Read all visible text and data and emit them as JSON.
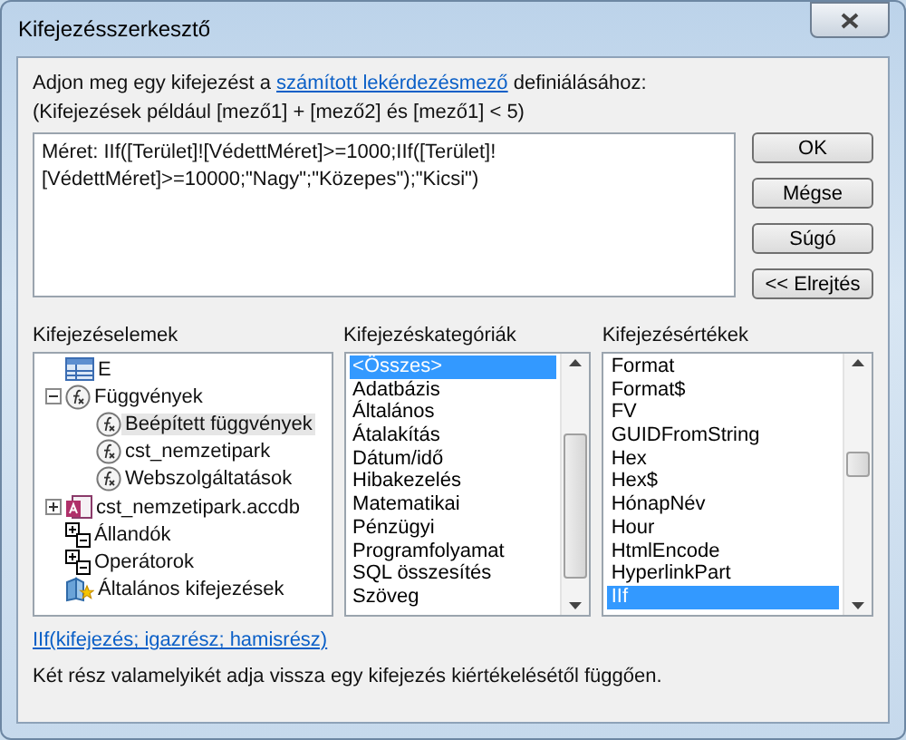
{
  "window": {
    "title": "Kifejezésszerkesztő"
  },
  "intro": {
    "before": "Adjon meg egy kifejezést a ",
    "link": "számított lekérdezésmező",
    "after": " definiálásához:"
  },
  "example": "(Kifejezések például [mező1] + [mező2] és [mező1] < 5)",
  "expression": "Méret: IIf([Terület]![VédettMéret]>=1000;IIf([Terület]![VédettMéret]>=10000;\"Nagy\";\"Közepes\");\"Kicsi\")",
  "buttons": [
    "OK",
    "Mégse",
    "Súgó",
    "<< Elrejtés"
  ],
  "elements": {
    "label": "Kifejezéselemek",
    "items": [
      {
        "label": "E",
        "kind": "table",
        "selected": false
      },
      {
        "label": "Függvények",
        "kind": "function",
        "expanded": true,
        "selected": false,
        "children": [
          {
            "label": "Beépített függvények",
            "kind": "function",
            "selected": true
          },
          {
            "label": "cst_nemzetipark",
            "kind": "function",
            "selected": false
          },
          {
            "label": "Webszolgáltatások",
            "kind": "function",
            "selected": false
          }
        ]
      },
      {
        "label": "cst_nemzetipark.accdb",
        "kind": "database",
        "expanded": false,
        "selected": false
      },
      {
        "label": "Állandók",
        "kind": "constants",
        "selected": false
      },
      {
        "label": "Operátorok",
        "kind": "constants",
        "selected": false
      },
      {
        "label": "Általános kifejezések",
        "kind": "common",
        "selected": false
      }
    ]
  },
  "categories": {
    "label": "Kifejezéskategóriák",
    "items": [
      {
        "label": "<Összes>",
        "selected": true
      },
      {
        "label": "Adatbázis",
        "selected": false
      },
      {
        "label": "Általános",
        "selected": false
      },
      {
        "label": "Átalakítás",
        "selected": false
      },
      {
        "label": "Dátum/idő",
        "selected": false
      },
      {
        "label": "Hibakezelés",
        "selected": false
      },
      {
        "label": "Matematikai",
        "selected": false
      },
      {
        "label": "Pénzügyi",
        "selected": false
      },
      {
        "label": "Programfolyamat",
        "selected": false
      },
      {
        "label": "SQL összesítés",
        "selected": false
      },
      {
        "label": "Szöveg",
        "selected": false
      }
    ]
  },
  "values": {
    "label": "Kifejezésértékek",
    "items": [
      {
        "label": "Format",
        "selected": false
      },
      {
        "label": "Format$",
        "selected": false
      },
      {
        "label": "FV",
        "selected": false
      },
      {
        "label": "GUIDFromString",
        "selected": false
      },
      {
        "label": "Hex",
        "selected": false
      },
      {
        "label": "Hex$",
        "selected": false
      },
      {
        "label": "HónapNév",
        "selected": false
      },
      {
        "label": "Hour",
        "selected": false
      },
      {
        "label": "HtmlEncode",
        "selected": false
      },
      {
        "label": "HyperlinkPart",
        "selected": false
      },
      {
        "label": "IIf",
        "selected": true
      }
    ]
  },
  "syntax": "IIf(kifejezés; igazrész; hamisrész)",
  "description": "Két rész valamelyikét adja vissza egy kifejezés kiértékelésétől függően."
}
